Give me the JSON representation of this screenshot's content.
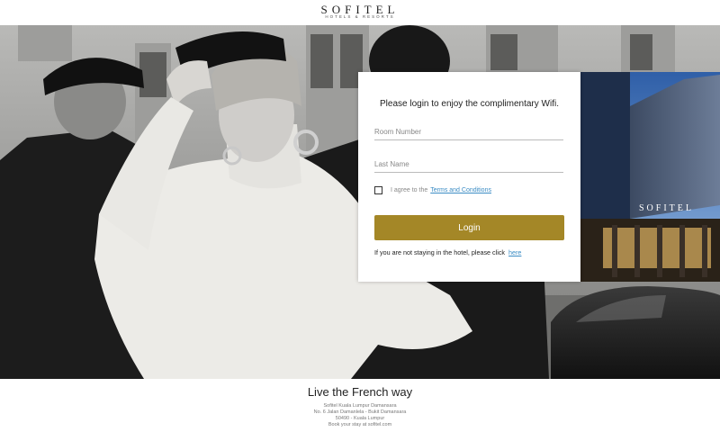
{
  "header": {
    "brand": "SOFITEL",
    "brand_sub": "HOTELS & RESORTS"
  },
  "hero": {
    "hotel_sign": "SOFITEL"
  },
  "login": {
    "title": "Please login to enjoy the complimentary Wifi.",
    "room_placeholder": "Room Number",
    "room_value": "",
    "lastname_placeholder": "Last Name",
    "lastname_value": "",
    "agree_text": "I agree to the",
    "terms_link": "Terms and Conditions",
    "agree_checked": false,
    "button_label": "Login",
    "not_staying_text": "If you are not staying in the hotel, please click",
    "here_link": "here"
  },
  "footer": {
    "tagline": "Live the French way",
    "address_line1": "Sofitel Kuala Lumpur Damansara",
    "address_line2": "No. 6 Jalan Damanlela - Bukit Damansara",
    "address_line3": "50490 - Kuala Lumpur",
    "address_line4": "Book your stay at sofitel.com"
  },
  "colors": {
    "accent": "#a48727",
    "link": "#3b8cc4"
  }
}
